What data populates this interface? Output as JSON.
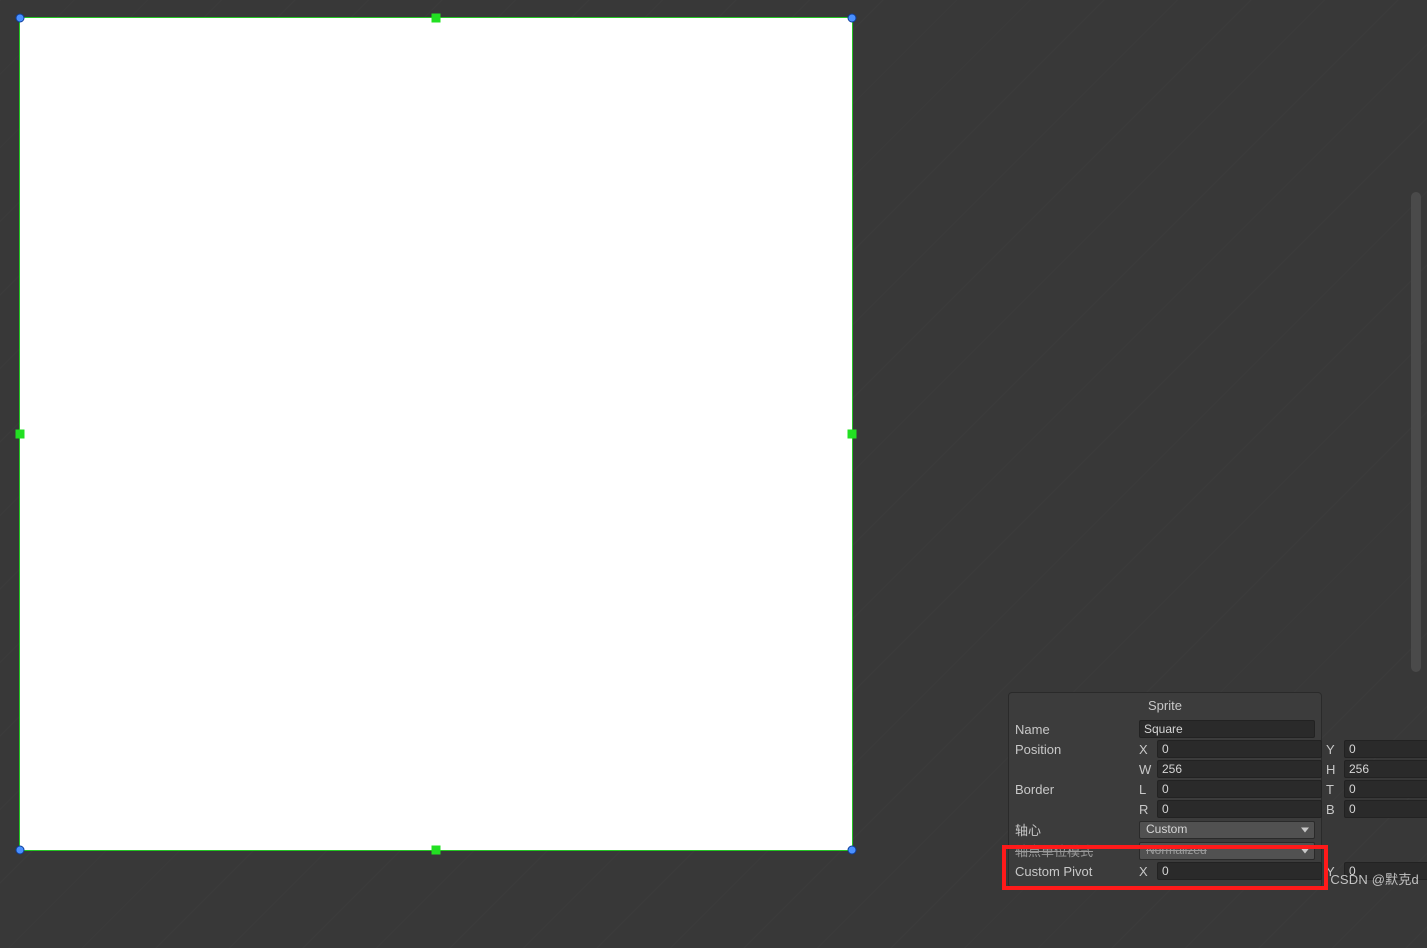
{
  "panel": {
    "title": "Sprite",
    "name_label": "Name",
    "name_value": "Square",
    "position_label": "Position",
    "position": {
      "x_label": "X",
      "x": "0",
      "y_label": "Y",
      "y": "0",
      "w_label": "W",
      "w": "256",
      "h_label": "H",
      "h": "256"
    },
    "border_label": "Border",
    "border": {
      "l_label": "L",
      "l": "0",
      "t_label": "T",
      "t": "0",
      "r_label": "R",
      "r": "0",
      "b_label": "B",
      "b": "0"
    },
    "pivot_label": "轴心",
    "pivot_value": "Custom",
    "pivot_unit_label": "轴点单位模式",
    "pivot_unit_value": "Normalized",
    "custom_pivot_label": "Custom Pivot",
    "custom_pivot": {
      "x_label": "X",
      "x": "0",
      "y_label": "Y",
      "y": "0"
    }
  },
  "watermark": "CSDN @默克d"
}
